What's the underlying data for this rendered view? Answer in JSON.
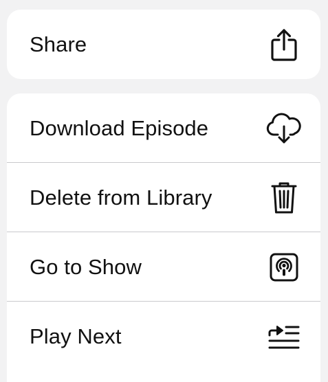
{
  "menu": {
    "share": {
      "label": "Share",
      "icon": "share-icon"
    },
    "items": [
      {
        "label": "Download Episode",
        "icon": "cloud-download-icon"
      },
      {
        "label": "Delete from Library",
        "icon": "trash-icon"
      },
      {
        "label": "Go to Show",
        "icon": "podcast-icon"
      },
      {
        "label": "Play Next",
        "icon": "play-next-icon"
      }
    ]
  },
  "colors": {
    "background": "#f2f2f3",
    "card": "#ffffff",
    "text": "#111111",
    "divider": "#c9c9cc"
  }
}
